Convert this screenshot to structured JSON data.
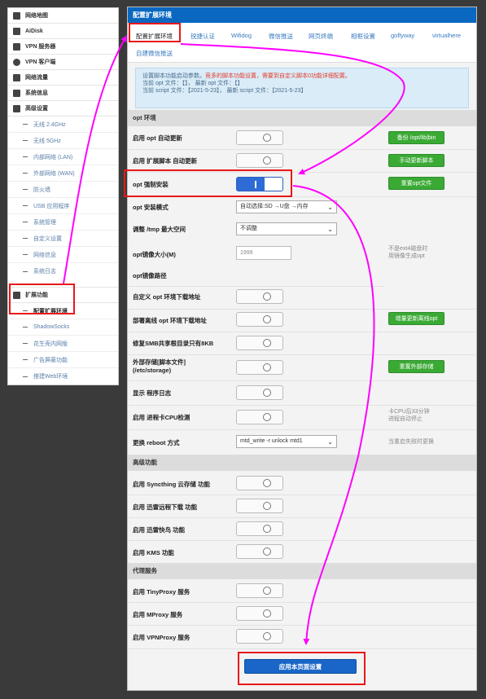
{
  "sidebar": {
    "items": [
      {
        "label": "网络地图",
        "icon": "home-icon"
      },
      {
        "label": "AiDisk",
        "icon": "disk-icon"
      },
      {
        "label": "VPN 服务器",
        "icon": "vpn-server-icon"
      },
      {
        "label": "VPN 客户端",
        "icon": "vpn-client-icon"
      },
      {
        "label": "网络流量",
        "icon": "traffic-icon"
      },
      {
        "label": "系统信息",
        "icon": "shuffle-icon"
      },
      {
        "label": "高级设置",
        "icon": "wrench-icon"
      }
    ],
    "advanced_sub": [
      "无线 2.4GHz",
      "无线 5GHz",
      "内部网络 (LAN)",
      "外部网络 (WAN)",
      "防火墙",
      "USB 应用程序",
      "系统管理",
      "自定义设置",
      "网络信息",
      "系统日志"
    ],
    "ext_label": "扩展功能",
    "ext_sub": [
      "配置扩展环境",
      "ShadowSocks",
      "花生壳内网版",
      "广告屏蔽功能",
      "搭建Web环境"
    ]
  },
  "main": {
    "title": "配置扩展环境",
    "tabs": [
      "配置扩展环境",
      "锐捷认证",
      "Wifidog",
      "微信推送",
      "网页终端",
      "相框设置",
      "goflyway",
      "virtualhere",
      "自建微信推送"
    ],
    "info": {
      "line1_a": "设置脚本功能启动参数。",
      "line1_b": "竞多的脚本功能设置，需要到自定义脚本0功能详细配置。",
      "line2": "当前 opt 文件：【】， 最新 opt 文件：【】",
      "line3": "当前 script 文件：【2021-5-23】， 最新 script 文件：【2021-5-23】"
    },
    "sections": {
      "opt_env": "opt 环境",
      "advanced": "高级功能",
      "proxy": "代理服务"
    },
    "rows": {
      "opt_auto_update": "启用 opt 自动更新",
      "ext_script_auto_update": "启用 扩展脚本 自动更新",
      "opt_force_install": "opt 强制安装",
      "opt_install_mode": "opt 安装模式",
      "tmp_size": "调整 /tmp 最大空间",
      "opt_image_size": "opt镜像大小(M)",
      "opt_image_path": "opt镜像路径",
      "custom_opt_url": "自定义 opt 环境下载地址",
      "deploy_offline_opt": "部署离线 opt 环境下载地址",
      "fix_smb": "修复SMB共享根目录只有8KB",
      "external_storage": "外部存储[脚本文件]",
      "external_storage_path": "(/etc/storage)",
      "show_log": "显示 程序日志",
      "cpu_check": "启用 进程卡CPU检测",
      "reboot_mode": "更换 reboot 方式",
      "syncthing": "启用 Syncthing 云存储 功能",
      "xunlei_download": "启用 迅雷远程下载 功能",
      "xunlei_kuainiao": "启用 迅雷快鸟 功能",
      "kms": "启用 KMS 功能",
      "tinyproxy": "启用 TinyProxy 服务",
      "mproxy": "启用 MProxy 服务",
      "vpnproxy": "启用 VPNProxy 服务"
    },
    "buttons": {
      "backup_opt": "备份 /opt/lib|bin",
      "manual_update_script": "手动更新脚本",
      "reset_opt": "重置opt文件",
      "incremental_offline_opt": "增量更新离线opt",
      "reset_external_storage": "重置外部存储",
      "apply": "应用本页面设置"
    },
    "selects": {
      "install_mode": "自动选择:SD →U盘 →内存",
      "tmp_size": "不调整",
      "reboot_mode": "mtd_write -r unlock mtd1"
    },
    "inputs": {
      "image_size_placeholder": "1999"
    },
    "notes": {
      "image_note_1": "不是ext4磁盘时",
      "image_note_2": "用镜像生成opt",
      "cpu_note_1": "卡CPU后33分钟",
      "cpu_note_2": "进程自动停止",
      "reboot_note": "当重启失败时更换"
    },
    "toggles": {
      "opt_force_install": true
    }
  },
  "colors": {
    "header_blue": "#0a68c0",
    "green_button": "#3aaa35",
    "highlight_red": "#e81818",
    "arrow_magenta": "#ff00ff"
  }
}
